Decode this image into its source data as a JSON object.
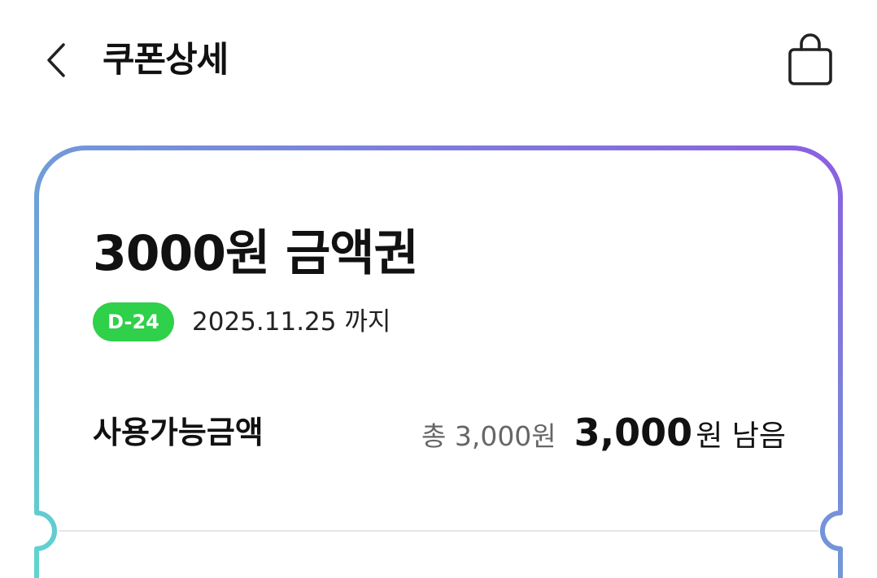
{
  "header": {
    "title": "쿠폰상세"
  },
  "coupon": {
    "title": "3000원 금액권",
    "dday_badge": "D-24",
    "expiry": "2025.11.25 까지",
    "available_label": "사용가능금액",
    "total_text": "총 3,000원",
    "remaining_amount": "3,000",
    "remaining_unit": "원 남음"
  },
  "icons": {
    "back": "chevron-left-icon",
    "bag": "shopping-bag-icon"
  },
  "colors": {
    "badge_green": "#2fd04a",
    "border_gradient_start": "#5fd6cf",
    "border_gradient_mid": "#6f9fd8",
    "border_gradient_end": "#8b5fe0"
  }
}
